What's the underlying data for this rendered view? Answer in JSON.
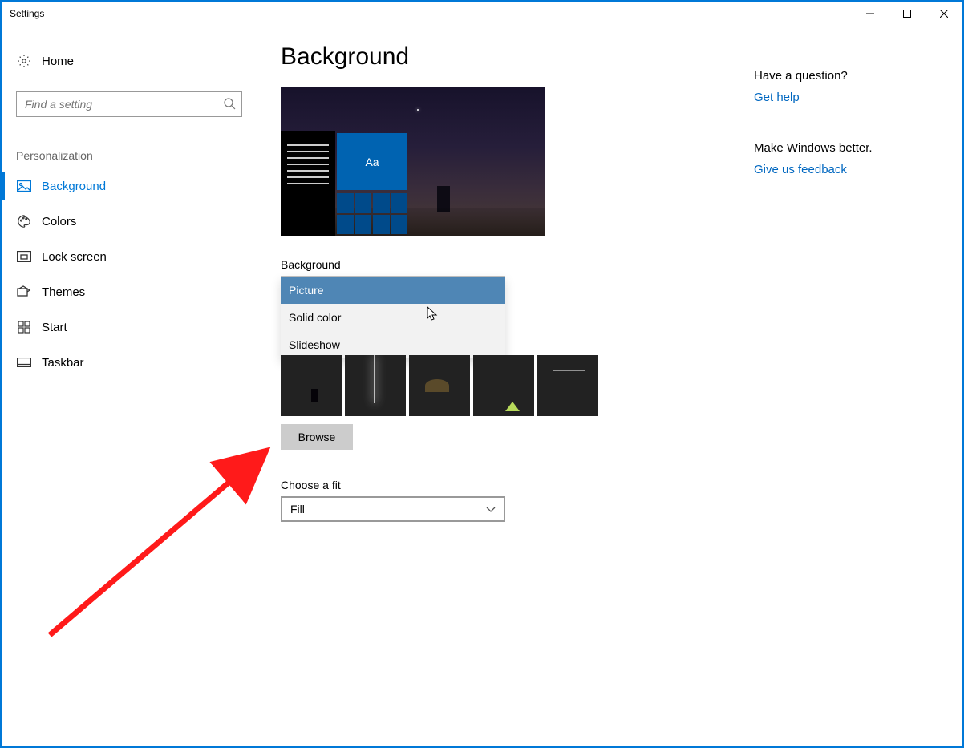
{
  "window": {
    "title": "Settings"
  },
  "sidebar": {
    "home_label": "Home",
    "search_placeholder": "Find a setting",
    "section_title": "Personalization",
    "items": [
      {
        "label": "Background"
      },
      {
        "label": "Colors"
      },
      {
        "label": "Lock screen"
      },
      {
        "label": "Themes"
      },
      {
        "label": "Start"
      },
      {
        "label": "Taskbar"
      }
    ]
  },
  "main": {
    "title": "Background",
    "preview_tile_text": "Aa",
    "bg_label": "Background",
    "bg_options": [
      "Picture",
      "Solid color",
      "Slideshow"
    ],
    "bg_selected": "Picture",
    "browse_label": "Browse",
    "fit_label": "Choose a fit",
    "fit_selected": "Fill"
  },
  "rightpane": {
    "q_heading": "Have a question?",
    "q_link": "Get help",
    "fb_heading": "Make Windows better.",
    "fb_link": "Give us feedback"
  }
}
